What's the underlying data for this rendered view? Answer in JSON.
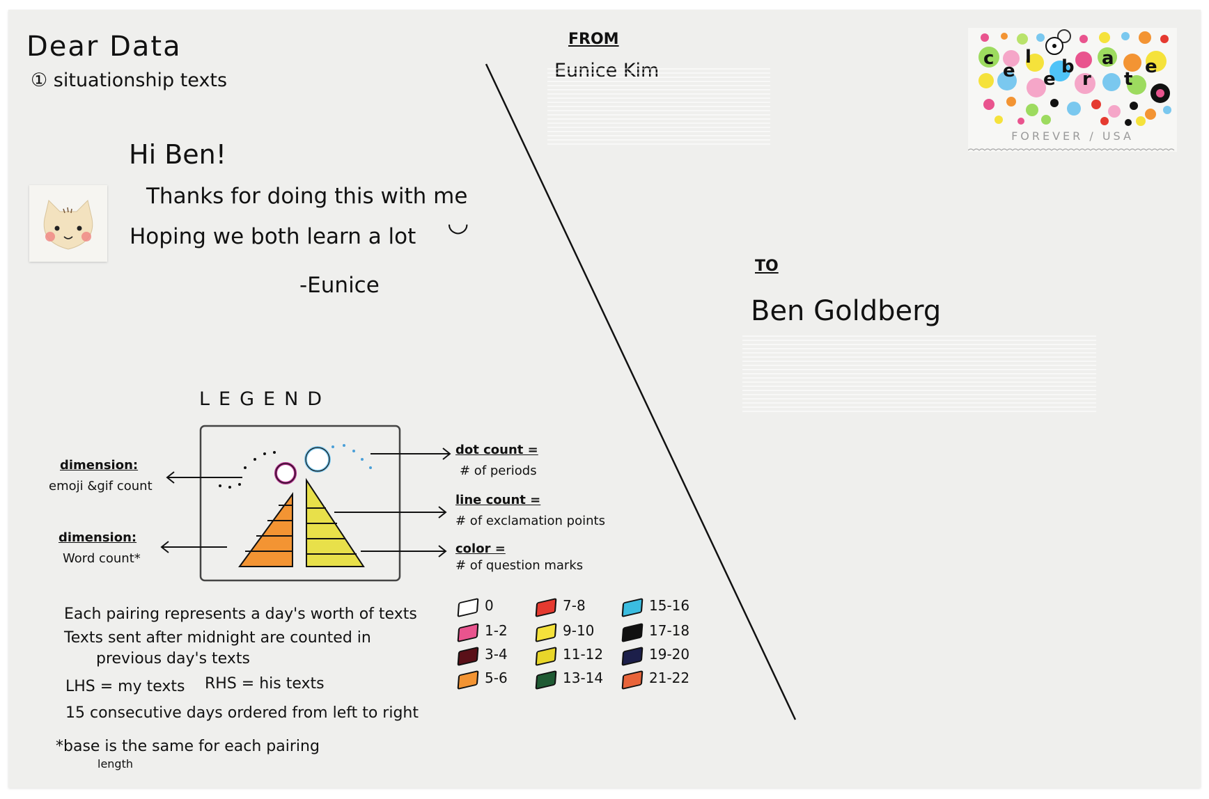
{
  "header": {
    "title": "Dear Data",
    "subtitle": "① situationship texts"
  },
  "message": {
    "greeting": "Hi Ben!",
    "line1": "Thanks for doing this with me",
    "line2": "Hoping we both learn a lot",
    "smiley": "◡",
    "signature": "-Eunice"
  },
  "from": {
    "label": "FROM",
    "name": "Eunice Kim"
  },
  "to": {
    "label": "TO",
    "name": "Ben Goldberg"
  },
  "stamp": {
    "text": "FOREVER / USA",
    "letters": [
      "c",
      "e",
      "l",
      "e",
      "b",
      "r",
      "a",
      "t",
      "e"
    ]
  },
  "legend": {
    "title": "LEGEND",
    "left_top_heading": "dimension:",
    "left_top_desc": "emoji &gif count",
    "left_bottom_heading": "dimension:",
    "left_bottom_desc": "Word count*",
    "right1_heading": "dot count =",
    "right1_desc": "# of periods",
    "right2_heading": "line count =",
    "right2_desc": "# of exclamation points",
    "right3_heading": "color =",
    "right3_desc": "# of question marks"
  },
  "color_key": [
    {
      "label": "0",
      "color": "#ffffff"
    },
    {
      "label": "1-2",
      "color": "#e9548e"
    },
    {
      "label": "3-4",
      "color": "#5a1018"
    },
    {
      "label": "5-6",
      "color": "#f39433"
    },
    {
      "label": "7-8",
      "color": "#e53a30"
    },
    {
      "label": "9-10",
      "color": "#f5e23b"
    },
    {
      "label": "11-12",
      "color": "#e8d62a"
    },
    {
      "label": "13-14",
      "color": "#1f5a33"
    },
    {
      "label": "15-16",
      "color": "#3bbde0"
    },
    {
      "label": "17-18",
      "color": "#111111"
    },
    {
      "label": "19-20",
      "color": "#1c1f4a"
    },
    {
      "label": "21-22",
      "color": "#e8643a"
    }
  ],
  "notes": {
    "n1": "Each pairing represents a day's worth of texts",
    "n2": "Texts sent after midnight are counted in",
    "n3": "previous day's texts",
    "n4a": "LHS = my texts",
    "n4b": "RHS = his texts",
    "n5": "15 consecutive days ordered from left to right",
    "n6": "*base is the same for each pairing",
    "n6b": "length"
  }
}
